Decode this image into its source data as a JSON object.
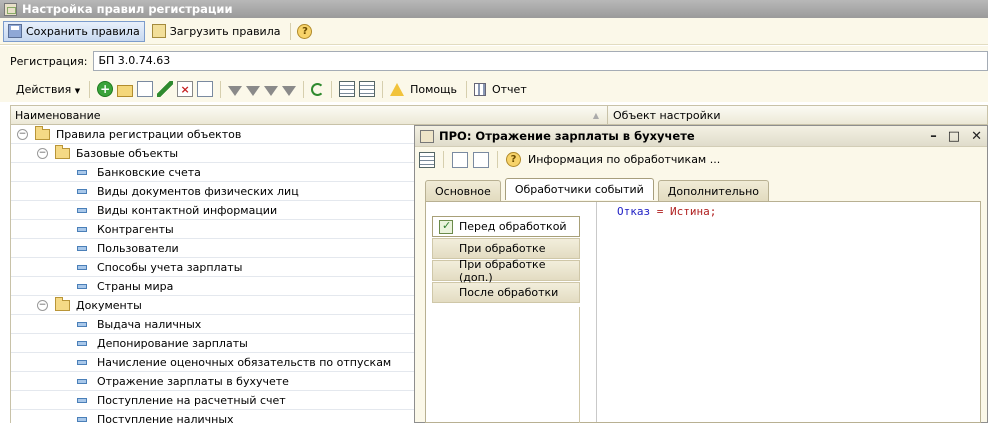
{
  "window": {
    "title": "Настройка правил регистрации"
  },
  "toolbar": {
    "save_label": "Сохранить правила",
    "load_label": "Загрузить правила",
    "help_glyph": "?"
  },
  "registration": {
    "label": "Регистрация:",
    "value": "БП 3.0.74.63"
  },
  "actions_toolbar": {
    "actions_label": "Действия",
    "help_label": "Помощь",
    "report_label": "Отчет"
  },
  "grid": {
    "columns": [
      "Наименование",
      "Объект настройки"
    ]
  },
  "tree": {
    "root": {
      "label": "Правила регистрации объектов"
    },
    "groups": [
      {
        "label": "Базовые объекты",
        "items": [
          "Банковские счета",
          "Виды документов физических лиц",
          "Виды контактной информации",
          "Контрагенты",
          "Пользователи",
          "Способы учета зарплаты",
          "Страны мира"
        ]
      },
      {
        "label": "Документы",
        "items": [
          "Выдача наличных",
          "Депонирование зарплаты",
          "Начисление оценочных обязательств по отпускам",
          "Отражение зарплаты в бухучете",
          "Поступление на расчетный счет",
          "Поступление наличных"
        ]
      }
    ]
  },
  "panel": {
    "title": "ПРО: Отражение зарплаты в бухучете",
    "toolbar_info_label": "Информация по обработчикам ...",
    "tabs": [
      "Основное",
      "Обработчики событий",
      "Дополнительно"
    ],
    "active_tab": "Обработчики событий",
    "events": [
      "Перед обработкой",
      "При обработке",
      "При обработке (доп.)",
      "После обработки"
    ],
    "code": {
      "kw1": "Отказ",
      "op": " = ",
      "kw2": "Истина;"
    }
  }
}
